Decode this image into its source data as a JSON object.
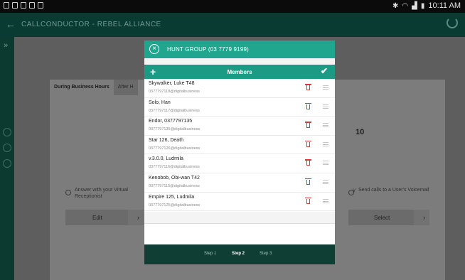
{
  "status_bar": {
    "time": "10:11 AM",
    "icons": [
      "notification-icon",
      "bluetooth-icon",
      "wifi-icon",
      "signal-icon",
      "battery-icon"
    ]
  },
  "app_bar": {
    "title": "CALLCONDUCTOR  -  REBEL ALLIANCE",
    "icons": [
      "back-arrow-icon",
      "refresh-icon"
    ]
  },
  "background": {
    "tabs": [
      "During Business Hours",
      "After H"
    ],
    "right_number": "10",
    "options": [
      {
        "label": "Answer with your Virtual Receptionist",
        "button": "Edit"
      },
      {
        "label": "Send calls to a User's Voicemail",
        "button": "Select"
      }
    ],
    "partial_letter": "y"
  },
  "dialog": {
    "title": "HUNT GROUP (03 7779 9199)",
    "members_title": "Members",
    "members": [
      {
        "name": "Skywalker, Luke T48",
        "email": "0377797118@digitalbusiness"
      },
      {
        "name": "Solo, Han",
        "email": "0377797117@digitalbusiness"
      },
      {
        "name": "Endor, 0377797135",
        "email": "0377797135@digitalbusiness"
      },
      {
        "name": "Star 126, Death",
        "email": "0377797126@digitalbusiness"
      },
      {
        "name": "v.3.0.0, Ludmila",
        "email": "0377797116@digitalbusiness"
      },
      {
        "name": "Kenobob, Obi-wan T42",
        "email": "0377797115@digitalbusiness"
      },
      {
        "name": "Empire 125, Ludmila",
        "email": "0377797125@digitalbusiness"
      }
    ],
    "steps": [
      "Step 1",
      "Step 2",
      "Step 3"
    ],
    "current_step": "Step 2"
  },
  "colors": {
    "accent": "#1d9a84",
    "header": "#20a58f",
    "app_bar": "#0a3b32",
    "delete": "#d93a3a"
  }
}
